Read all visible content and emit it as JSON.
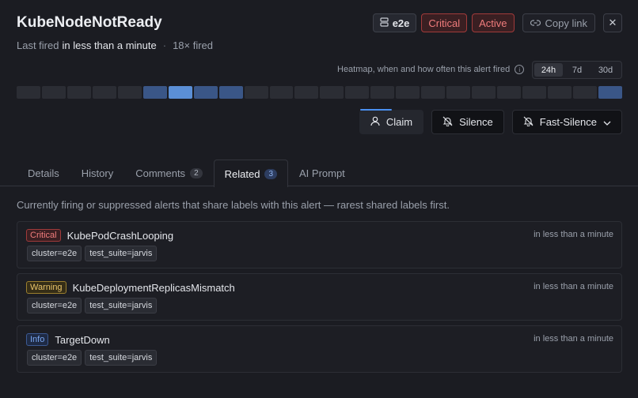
{
  "header": {
    "title": "KubeNodeNotReady",
    "last_fired_label": "Last fired",
    "last_fired_value": "in less than a minute",
    "fired_count": "18× fired",
    "env_tag": "e2e",
    "severity": "Critical",
    "status": "Active",
    "copy_link": "Copy link",
    "close_glyph": "✕"
  },
  "heatmap": {
    "label": "Heatmap, when and how often this alert fired",
    "ranges": [
      "24h",
      "7d",
      "30d"
    ],
    "selected_range": "24h",
    "levels": [
      0,
      0,
      0,
      0,
      0,
      1,
      2,
      1,
      1,
      0,
      0,
      0,
      0,
      0,
      0,
      0,
      0,
      0,
      0,
      0,
      0,
      0,
      0,
      1
    ]
  },
  "actions": {
    "claim": "Claim",
    "silence": "Silence",
    "fast_silence": "Fast-Silence"
  },
  "tabs": [
    {
      "label": "Details",
      "count": ""
    },
    {
      "label": "History",
      "count": ""
    },
    {
      "label": "Comments",
      "count": "2"
    },
    {
      "label": "Related",
      "count": "3"
    },
    {
      "label": "AI Prompt",
      "count": ""
    }
  ],
  "active_tab": "Related",
  "related": {
    "description": "Currently firing or suppressed alerts that share labels with this alert — rarest shared labels first.",
    "items": [
      {
        "severity": "Critical",
        "name": "KubePodCrashLooping",
        "time": "in less than a minute",
        "labels": [
          "cluster=e2e",
          "test_suite=jarvis"
        ]
      },
      {
        "severity": "Warning",
        "name": "KubeDeploymentReplicasMismatch",
        "time": "in less than a minute",
        "labels": [
          "cluster=e2e",
          "test_suite=jarvis"
        ]
      },
      {
        "severity": "Info",
        "name": "TargetDown",
        "time": "in less than a minute",
        "labels": [
          "cluster=e2e",
          "test_suite=jarvis"
        ]
      }
    ]
  }
}
